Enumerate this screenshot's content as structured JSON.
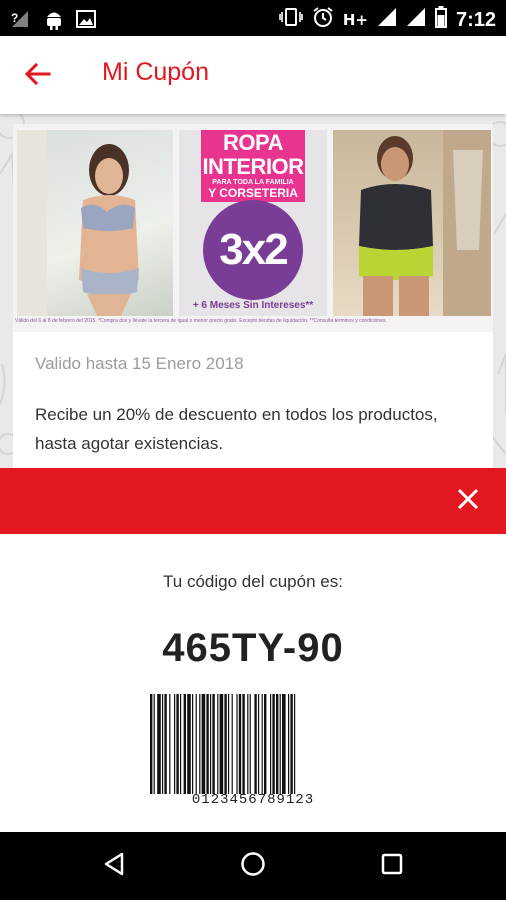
{
  "status_bar": {
    "time": "7:12",
    "network": "H+",
    "icons": [
      "signal-unknown-icon",
      "android-icon",
      "image-icon",
      "vibrate-icon",
      "alarm-icon",
      "signal-icon",
      "wifi-signal-icon",
      "battery-icon"
    ]
  },
  "app_bar": {
    "title": "Mi Cupón",
    "back_icon": "arrow-back-icon",
    "accent_color": "#e3171f"
  },
  "coupon": {
    "promo": {
      "line1": "ROPA",
      "line2": "INTERIOR",
      "line3": "PARA TODA LA FAMILIA",
      "line4": "Y CORSETERIA",
      "offer": "3x2",
      "extra": "+ 6 Meses Sin Intereses**",
      "legal": "Válido del 6 al 8 de febrero del 2015. *Compra dos y llévate la tercera de igual o menor precio gratis. Excepto tiendas de liquidación. **Consulta términos y condiciones."
    },
    "valid_until": "Valido hasta 15 Enero 2018",
    "description": "Recibe un 20% de descuento en todos los productos, hasta agotar existencias."
  },
  "close_bar": {
    "close_icon": "close-icon",
    "color": "#e3171f"
  },
  "code": {
    "label": "Tu código del cupón es:",
    "value": "465TY-90",
    "barcode_digits": "0123456789123"
  },
  "nav_bar": {
    "icons": [
      "back-triangle-icon",
      "home-circle-icon",
      "recents-square-icon"
    ]
  }
}
